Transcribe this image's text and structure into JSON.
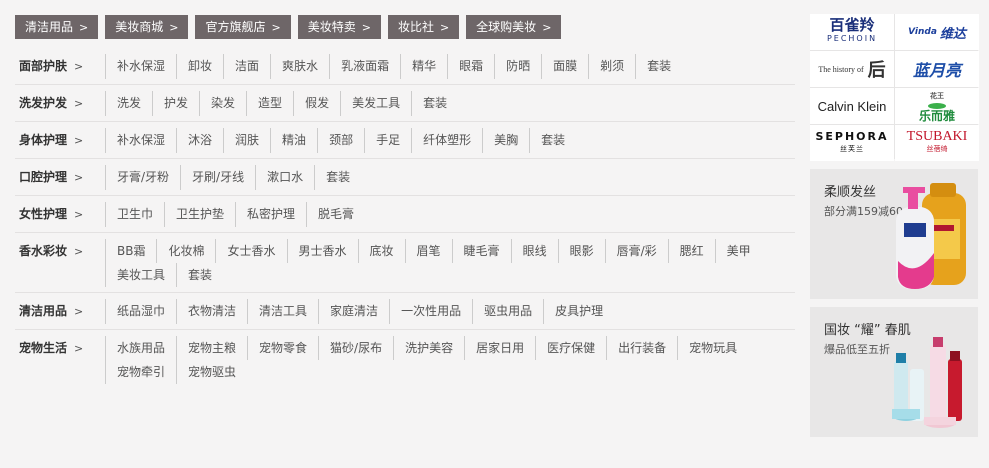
{
  "tabs": [
    {
      "label": "清洁用品"
    },
    {
      "label": "美妆商城"
    },
    {
      "label": "官方旗舰店"
    },
    {
      "label": "美妆特卖"
    },
    {
      "label": "妆比社"
    },
    {
      "label": "全球购美妆"
    }
  ],
  "chevron": ">",
  "categories": [
    {
      "title": "面部护肤",
      "items": [
        "补水保湿",
        "卸妆",
        "洁面",
        "爽肤水",
        "乳液面霜",
        "精华",
        "眼霜",
        "防晒",
        "面膜",
        "剃须",
        "套装"
      ]
    },
    {
      "title": "洗发护发",
      "items": [
        "洗发",
        "护发",
        "染发",
        "造型",
        "假发",
        "美发工具",
        "套装"
      ]
    },
    {
      "title": "身体护理",
      "items": [
        "补水保湿",
        "沐浴",
        "润肤",
        "精油",
        "颈部",
        "手足",
        "纤体塑形",
        "美胸",
        "套装"
      ]
    },
    {
      "title": "口腔护理",
      "items": [
        "牙膏/牙粉",
        "牙刷/牙线",
        "漱口水",
        "套装"
      ]
    },
    {
      "title": "女性护理",
      "items": [
        "卫生巾",
        "卫生护垫",
        "私密护理",
        "脱毛膏"
      ]
    },
    {
      "title": "香水彩妆",
      "items": [
        "BB霜",
        "化妆棉",
        "女士香水",
        "男士香水",
        "底妆",
        "眉笔",
        "睫毛膏",
        "眼线",
        "眼影",
        "唇膏/彩",
        "腮红",
        "美甲",
        "美妆工具",
        "套装"
      ]
    },
    {
      "title": "清洁用品",
      "items": [
        "纸品湿巾",
        "衣物清洁",
        "清洁工具",
        "家庭清洁",
        "一次性用品",
        "驱虫用品",
        "皮具护理"
      ]
    },
    {
      "title": "宠物生活",
      "items": [
        "水族用品",
        "宠物主粮",
        "宠物零食",
        "猫砂/尿布",
        "洗护美容",
        "居家日用",
        "医疗保健",
        "出行装备",
        "宠物玩具",
        "宠物牵引",
        "宠物驱虫"
      ]
    }
  ],
  "brands": {
    "pechoin": {
      "main": "百雀羚",
      "sub": "PECHOIN"
    },
    "vinda": {
      "main": "维达",
      "sub": "Vinda"
    },
    "whoo": {
      "main": "The history of",
      "mark": "后"
    },
    "lanyue": {
      "main": "蓝月亮"
    },
    "ck": {
      "main": "Calvin Klein"
    },
    "lewei": {
      "top": "花王",
      "main": "乐而雅"
    },
    "sephora": {
      "main": "SEPHORA",
      "sub": "丝芙兰"
    },
    "tsubaki": {
      "main": "TSUBAKI",
      "sub": "丝蓓绮"
    }
  },
  "promos": [
    {
      "title": "柔顺发丝",
      "subtitle": "部分满159减60"
    },
    {
      "title": "国妆 “耀” 春肌",
      "subtitle": "爆品低至五折"
    }
  ],
  "colors": {
    "tab_bg": "#6e6668",
    "page_bg": "#f5f4f4",
    "promo_bg": "#e8e7e7"
  }
}
